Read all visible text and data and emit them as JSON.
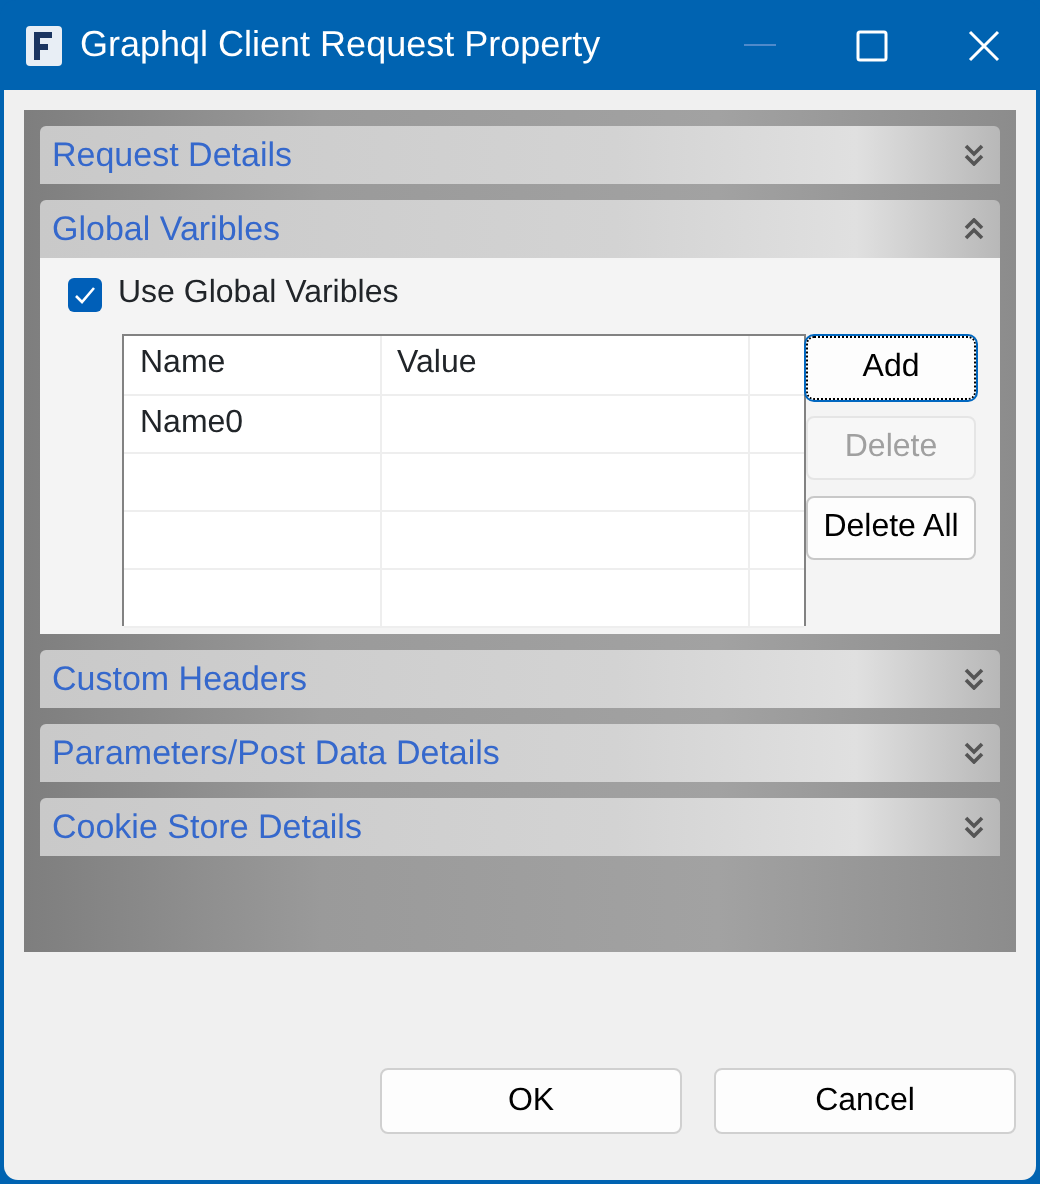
{
  "window": {
    "title": "Graphql Client Request Property"
  },
  "sections": [
    {
      "title": "Request Details",
      "expanded": false
    },
    {
      "title": "Global Varibles",
      "expanded": true,
      "content": {
        "checkbox": {
          "label": "Use Global Varibles",
          "checked": true
        },
        "table": {
          "columns": [
            "Name",
            "Value"
          ],
          "rows": [
            {
              "name": "Name0"
            }
          ]
        },
        "buttons": [
          {
            "label": "Add",
            "disabled": false,
            "focused": true
          },
          {
            "label": "Delete",
            "disabled": true,
            "focused": false
          },
          {
            "label": "Delete All",
            "disabled": false,
            "focused": false
          }
        ]
      }
    },
    {
      "title": "Custom Headers",
      "expanded": false
    },
    {
      "title": "Parameters/Post Data Details",
      "expanded": false
    },
    {
      "title": "Cookie Store Details",
      "expanded": false
    }
  ],
  "buttons": [
    "OK",
    "Cancel"
  ]
}
